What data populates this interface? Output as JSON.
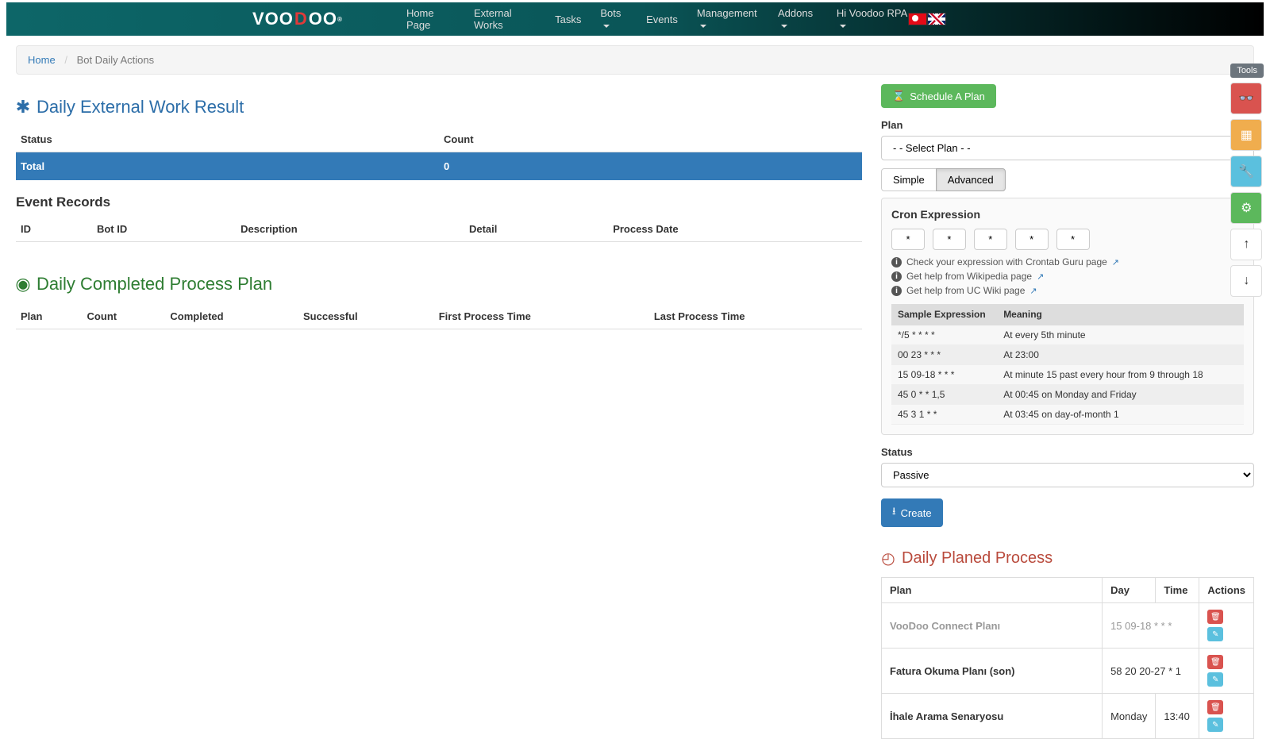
{
  "nav": {
    "home": "Home Page",
    "external": "External Works",
    "tasks": "Tasks",
    "bots": "Bots",
    "events": "Events",
    "management": "Management",
    "addons": "Addons",
    "user": "Hi Voodoo RPA"
  },
  "breadcrumb": {
    "home": "Home",
    "current": "Bot Daily Actions"
  },
  "left": {
    "external_title": "Daily External Work Result",
    "status_h": "Status",
    "count_h": "Count",
    "total_label": "Total",
    "total_value": "0",
    "event_records_title": "Event Records",
    "er_id": "ID",
    "er_botid": "Bot ID",
    "er_desc": "Description",
    "er_detail": "Detail",
    "er_date": "Process Date",
    "completed_title": "Daily Completed Process Plan",
    "cp_plan": "Plan",
    "cp_count": "Count",
    "cp_completed": "Completed",
    "cp_success": "Successful",
    "cp_first": "First Process Time",
    "cp_last": "Last Process Time"
  },
  "right": {
    "schedule_btn": "Schedule A Plan",
    "plan_label": "Plan",
    "plan_placeholder": "- - Select Plan - -",
    "simple": "Simple",
    "advanced": "Advanced",
    "cron_title": "Cron Expression",
    "cron_val": "*",
    "help1": "Check your expression with Crontab Guru page",
    "help2": "Get help from Wikipedia page",
    "help3": "Get help from UC Wiki page",
    "sample_h": "Sample Expression",
    "meaning_h": "Meaning",
    "samples": [
      {
        "e": "*/5 * * * *",
        "m": "At every 5th minute"
      },
      {
        "e": "00 23 * * *",
        "m": "At 23:00"
      },
      {
        "e": "15 09-18 * * *",
        "m": "At minute 15 past every hour from 9 through 18"
      },
      {
        "e": "45 0 * * 1,5",
        "m": "At 00:45 on Monday and Friday"
      },
      {
        "e": "45 3 1 * *",
        "m": "At 03:45 on day-of-month 1"
      }
    ],
    "status_label": "Status",
    "status_value": "Passive",
    "create_btn": "Create",
    "planned_title": "Daily Planed Process",
    "pt_plan": "Plan",
    "pt_day": "Day",
    "pt_time": "Time",
    "pt_actions": "Actions",
    "planned": [
      {
        "plan": "VooDoo Connect Planı",
        "day": "",
        "time": "15 09-18 * * *",
        "muted": true
      },
      {
        "plan": "Fatura Okuma Planı (son)",
        "day": "",
        "time": "58 20 20-27 * 1",
        "muted": false
      },
      {
        "plan": "İhale Arama Senaryosu",
        "day": "Monday",
        "time": "13:40",
        "muted": false
      }
    ]
  },
  "tools_label": "Tools"
}
